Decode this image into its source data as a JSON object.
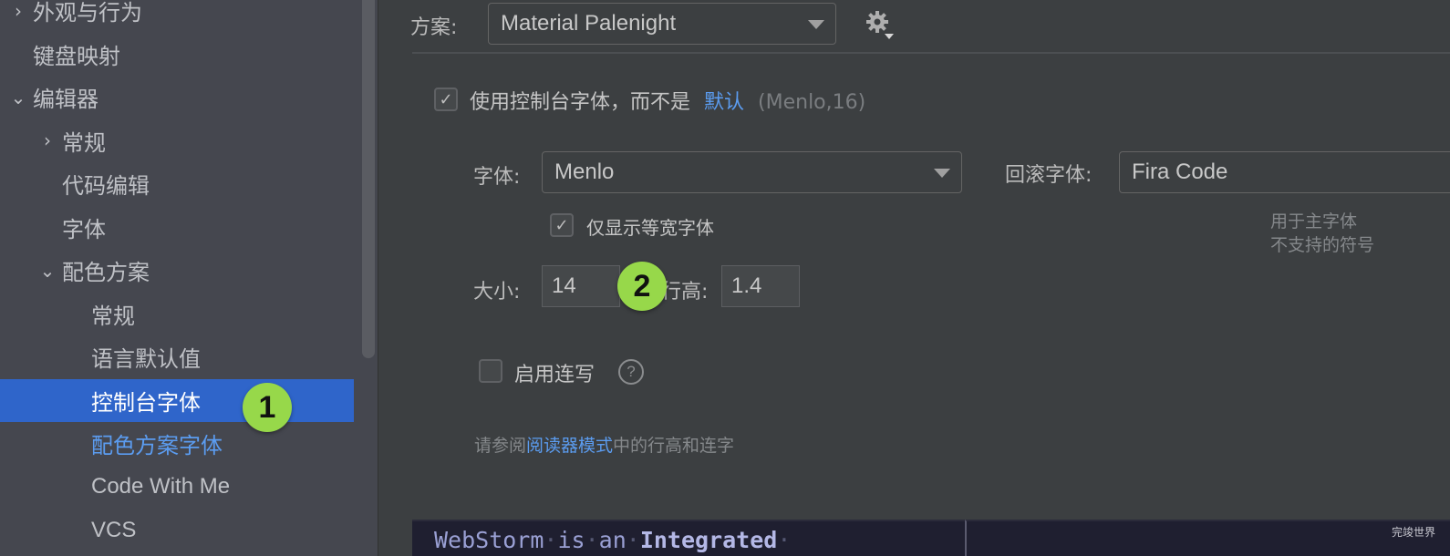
{
  "sidebar": {
    "items": [
      {
        "label": "外观与行为",
        "chevron": "›",
        "level": 0
      },
      {
        "label": "键盘映射",
        "chevron": "",
        "level": 0
      },
      {
        "label": "编辑器",
        "chevron": "⌄",
        "level": 0
      },
      {
        "label": "常规",
        "chevron": "›",
        "level": 1
      },
      {
        "label": "代码编辑",
        "chevron": "",
        "level": 1
      },
      {
        "label": "字体",
        "chevron": "",
        "level": 1
      },
      {
        "label": "配色方案",
        "chevron": "⌄",
        "level": 1
      },
      {
        "label": "常规",
        "chevron": "",
        "level": 2
      },
      {
        "label": "语言默认值",
        "chevron": "",
        "level": 2
      },
      {
        "label": "控制台字体",
        "chevron": "",
        "level": 2,
        "selected": true
      },
      {
        "label": "配色方案字体",
        "chevron": "",
        "level": 2,
        "link": true
      },
      {
        "label": "Code With Me",
        "chevron": "",
        "level": 2
      },
      {
        "label": "VCS",
        "chevron": "",
        "level": 2
      }
    ]
  },
  "callouts": {
    "one": "1",
    "two": "2"
  },
  "scheme": {
    "label": "方案:",
    "value": "Material Palenight",
    "gear_icon": "gear-with-dropdown-icon"
  },
  "console_font": {
    "checked": true,
    "label": "使用控制台字体，而不是",
    "default_link": "默认",
    "default_info": "(Menlo,16)"
  },
  "font": {
    "label": "字体:",
    "value": "Menlo",
    "monospace_only_label": "仅显示等宽字体",
    "monospace_only_checked": true
  },
  "fallback_font": {
    "label": "回滚字体:",
    "value": "Fira Code",
    "hint_line1": "用于主字体",
    "hint_line2": "不支持的符号"
  },
  "size": {
    "label": "大小:",
    "value": "14"
  },
  "line_height": {
    "label": "行高:",
    "value": "1.4"
  },
  "ligatures": {
    "label": "启用连写",
    "checked": false,
    "help_icon": "?"
  },
  "reader_mode_hint": {
    "prefix": "请参阅",
    "link": "阅读器模式",
    "suffix": "中的行高和连字"
  },
  "preview": {
    "words": [
      "WebStorm",
      "is",
      "an",
      "Integrated"
    ],
    "bold_word_index": 3
  },
  "watermark": "完竣世界",
  "colors": {
    "selection": "#2f65ca",
    "link": "#5b9cf0",
    "callout": "#97d84a"
  }
}
